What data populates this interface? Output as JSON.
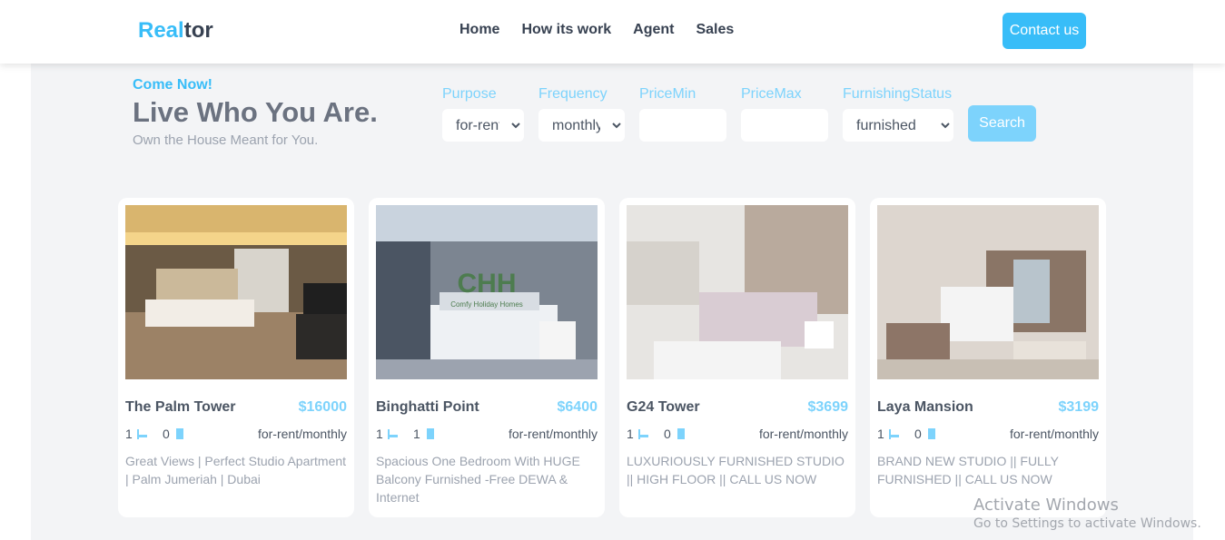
{
  "nav": {
    "logo_accent": "Real",
    "logo_rest": "tor",
    "links": [
      "Home",
      "How its work",
      "Agent",
      "Sales"
    ],
    "contact_label": "Contact us"
  },
  "hero": {
    "eyebrow": "Come Now!",
    "title": "Live Who You Are.",
    "subtitle": "Own the House Meant for You."
  },
  "filters": {
    "purpose": {
      "label": "Purpose",
      "value": "for-rent"
    },
    "frequency": {
      "label": "Frequency",
      "value": "monthly"
    },
    "price_min": {
      "label": "PriceMin",
      "value": ""
    },
    "price_max": {
      "label": "PriceMax",
      "value": ""
    },
    "furnishing": {
      "label": "FurnishingStatus",
      "value": "furnished"
    },
    "search_label": "Search"
  },
  "listings": [
    {
      "title": "The Palm Tower",
      "price": "$16000",
      "beds": "1",
      "baths": "0",
      "status": "for-rent/monthly",
      "desc": "Great Views | Perfect Studio Apartment | Palm Jumeriah | Dubai"
    },
    {
      "title": "Binghatti Point",
      "price": "$6400",
      "beds": "1",
      "baths": "1",
      "status": "for-rent/monthly",
      "desc": "Spacious One Bedroom With HUGE Balcony Furnished -Free DEWA & Internet",
      "img_watermark": "CHH",
      "img_watermark_sub": "Comfy Holiday Homes"
    },
    {
      "title": "G24 Tower",
      "price": "$3699",
      "beds": "1",
      "baths": "0",
      "status": "for-rent/monthly",
      "desc": "LUXURIOUSLY FURNISHED STUDIO || HIGH FLOOR || CALL US NOW"
    },
    {
      "title": "Laya Mansion",
      "price": "$3199",
      "beds": "1",
      "baths": "0",
      "status": "for-rent/monthly",
      "desc": "BRAND NEW STUDIO || FULLY FURNISHED || CALL US NOW"
    }
  ],
  "os_watermark": {
    "line1": "Activate Windows",
    "line2": "Go to Settings to activate Windows."
  },
  "colors": {
    "accent": "#38bdf8",
    "accent_light": "#7dd3fc",
    "text": "#374151",
    "muted": "#9ca3af",
    "bg": "#f3f4f6"
  }
}
